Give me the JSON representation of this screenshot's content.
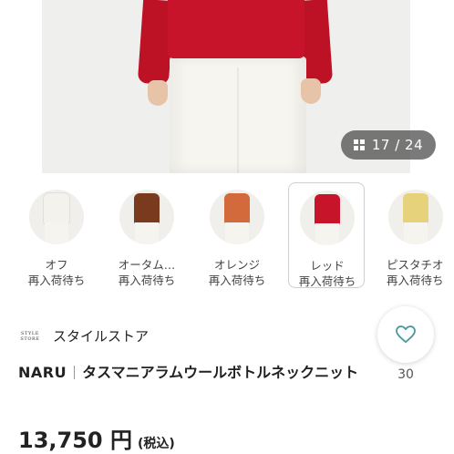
{
  "gallery": {
    "counter": "17 / 24"
  },
  "colors": [
    {
      "name": "オフ",
      "status": "再入荷待ち",
      "swatch": "#f4f2ec",
      "selected": false
    },
    {
      "name": "オータム…",
      "status": "再入荷待ち",
      "swatch": "#7a3a1e",
      "selected": false
    },
    {
      "name": "オレンジ",
      "status": "再入荷待ち",
      "swatch": "#d26a3b",
      "selected": false
    },
    {
      "name": "レッド",
      "status": "再入荷待ち",
      "swatch": "#c8142a",
      "selected": true
    },
    {
      "name": "ピスタチオ",
      "status": "再入荷待ち",
      "swatch": "#e6d27a",
      "selected": false
    }
  ],
  "store": {
    "logo_line1": "STYLE",
    "logo_line2": "STORE",
    "name": "スタイルストア"
  },
  "favorite": {
    "count": "30",
    "icon": "heart-outline-icon",
    "accent": "#4a9a9c"
  },
  "product": {
    "brand": "NARU",
    "title": "タスマニアラムウールボトルネックニット",
    "price": "13,750 円",
    "tax_label": "(税込)"
  }
}
